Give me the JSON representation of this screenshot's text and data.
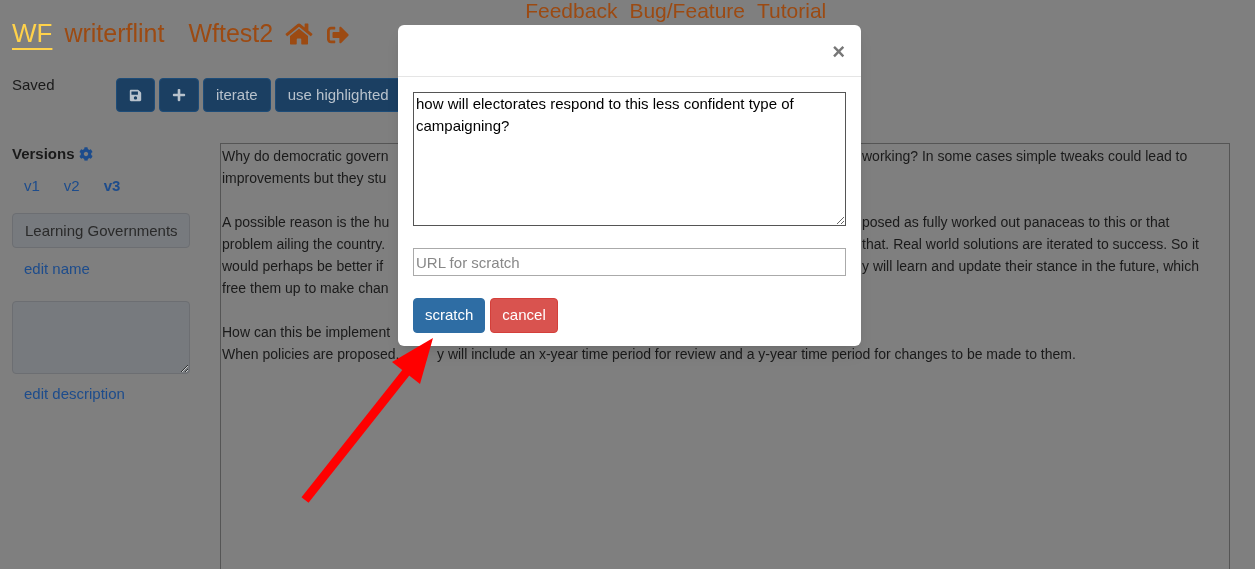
{
  "header": {
    "logo": "WF",
    "brand": "writerflint",
    "project": "Wftest2",
    "nav": [
      "Feedback",
      "Bug/Feature",
      "Tutorial"
    ]
  },
  "toolbar": {
    "status": "Saved",
    "buttons": [
      {
        "kind": "icon"
      },
      {
        "kind": "plus"
      },
      {
        "kind": "text",
        "label": "iterate"
      },
      {
        "kind": "text",
        "label": "use highlighted"
      }
    ]
  },
  "sidebar": {
    "title": "Versions",
    "versions": [
      {
        "label": "v1",
        "selected": false
      },
      {
        "label": "v2",
        "selected": false
      },
      {
        "label": "v3",
        "selected": true
      }
    ],
    "name_value": "Learning Governments",
    "edit_name": "edit name",
    "edit_description": "edit description"
  },
  "editor": {
    "lines": [
      {
        "kind": "behind_dialog",
        "left": "Why do democratic govern",
        "right": "working? In some cases simple tweaks could lead to"
      },
      {
        "kind": "behind_dialog",
        "left": "improvements but they stu"
      },
      {
        "kind": "blank"
      },
      {
        "kind": "behind_dialog",
        "left": "A possible reason is the hu",
        "right": "posed as fully worked out panaceas to this or that"
      },
      {
        "kind": "behind_dialog",
        "left": "problem ailing the country.",
        "right": "that. Real world solutions are iterated to success. So it"
      },
      {
        "kind": "behind_dialog",
        "left": "would perhaps be better if",
        "right": "y will learn and update their stance in the future, which"
      },
      {
        "kind": "behind_dialog",
        "left": "free them up to make chan"
      },
      {
        "kind": "blank"
      },
      {
        "kind": "behind_dialog",
        "left": "How can this be implement"
      },
      {
        "kind": "behind_arrow",
        "left": "When policies are proposed,",
        "right": "y will include an x-year time period for review and a y-year time period for changes to be made to them."
      }
    ]
  },
  "dialog": {
    "close": "×",
    "text_value": "how will electorates respond to this less confident type of campaigning?",
    "url_placeholder": "URL for scratch",
    "buttons": [
      {
        "kind": "primary",
        "label": "scratch"
      },
      {
        "kind": "danger",
        "label": "cancel"
      }
    ]
  }
}
